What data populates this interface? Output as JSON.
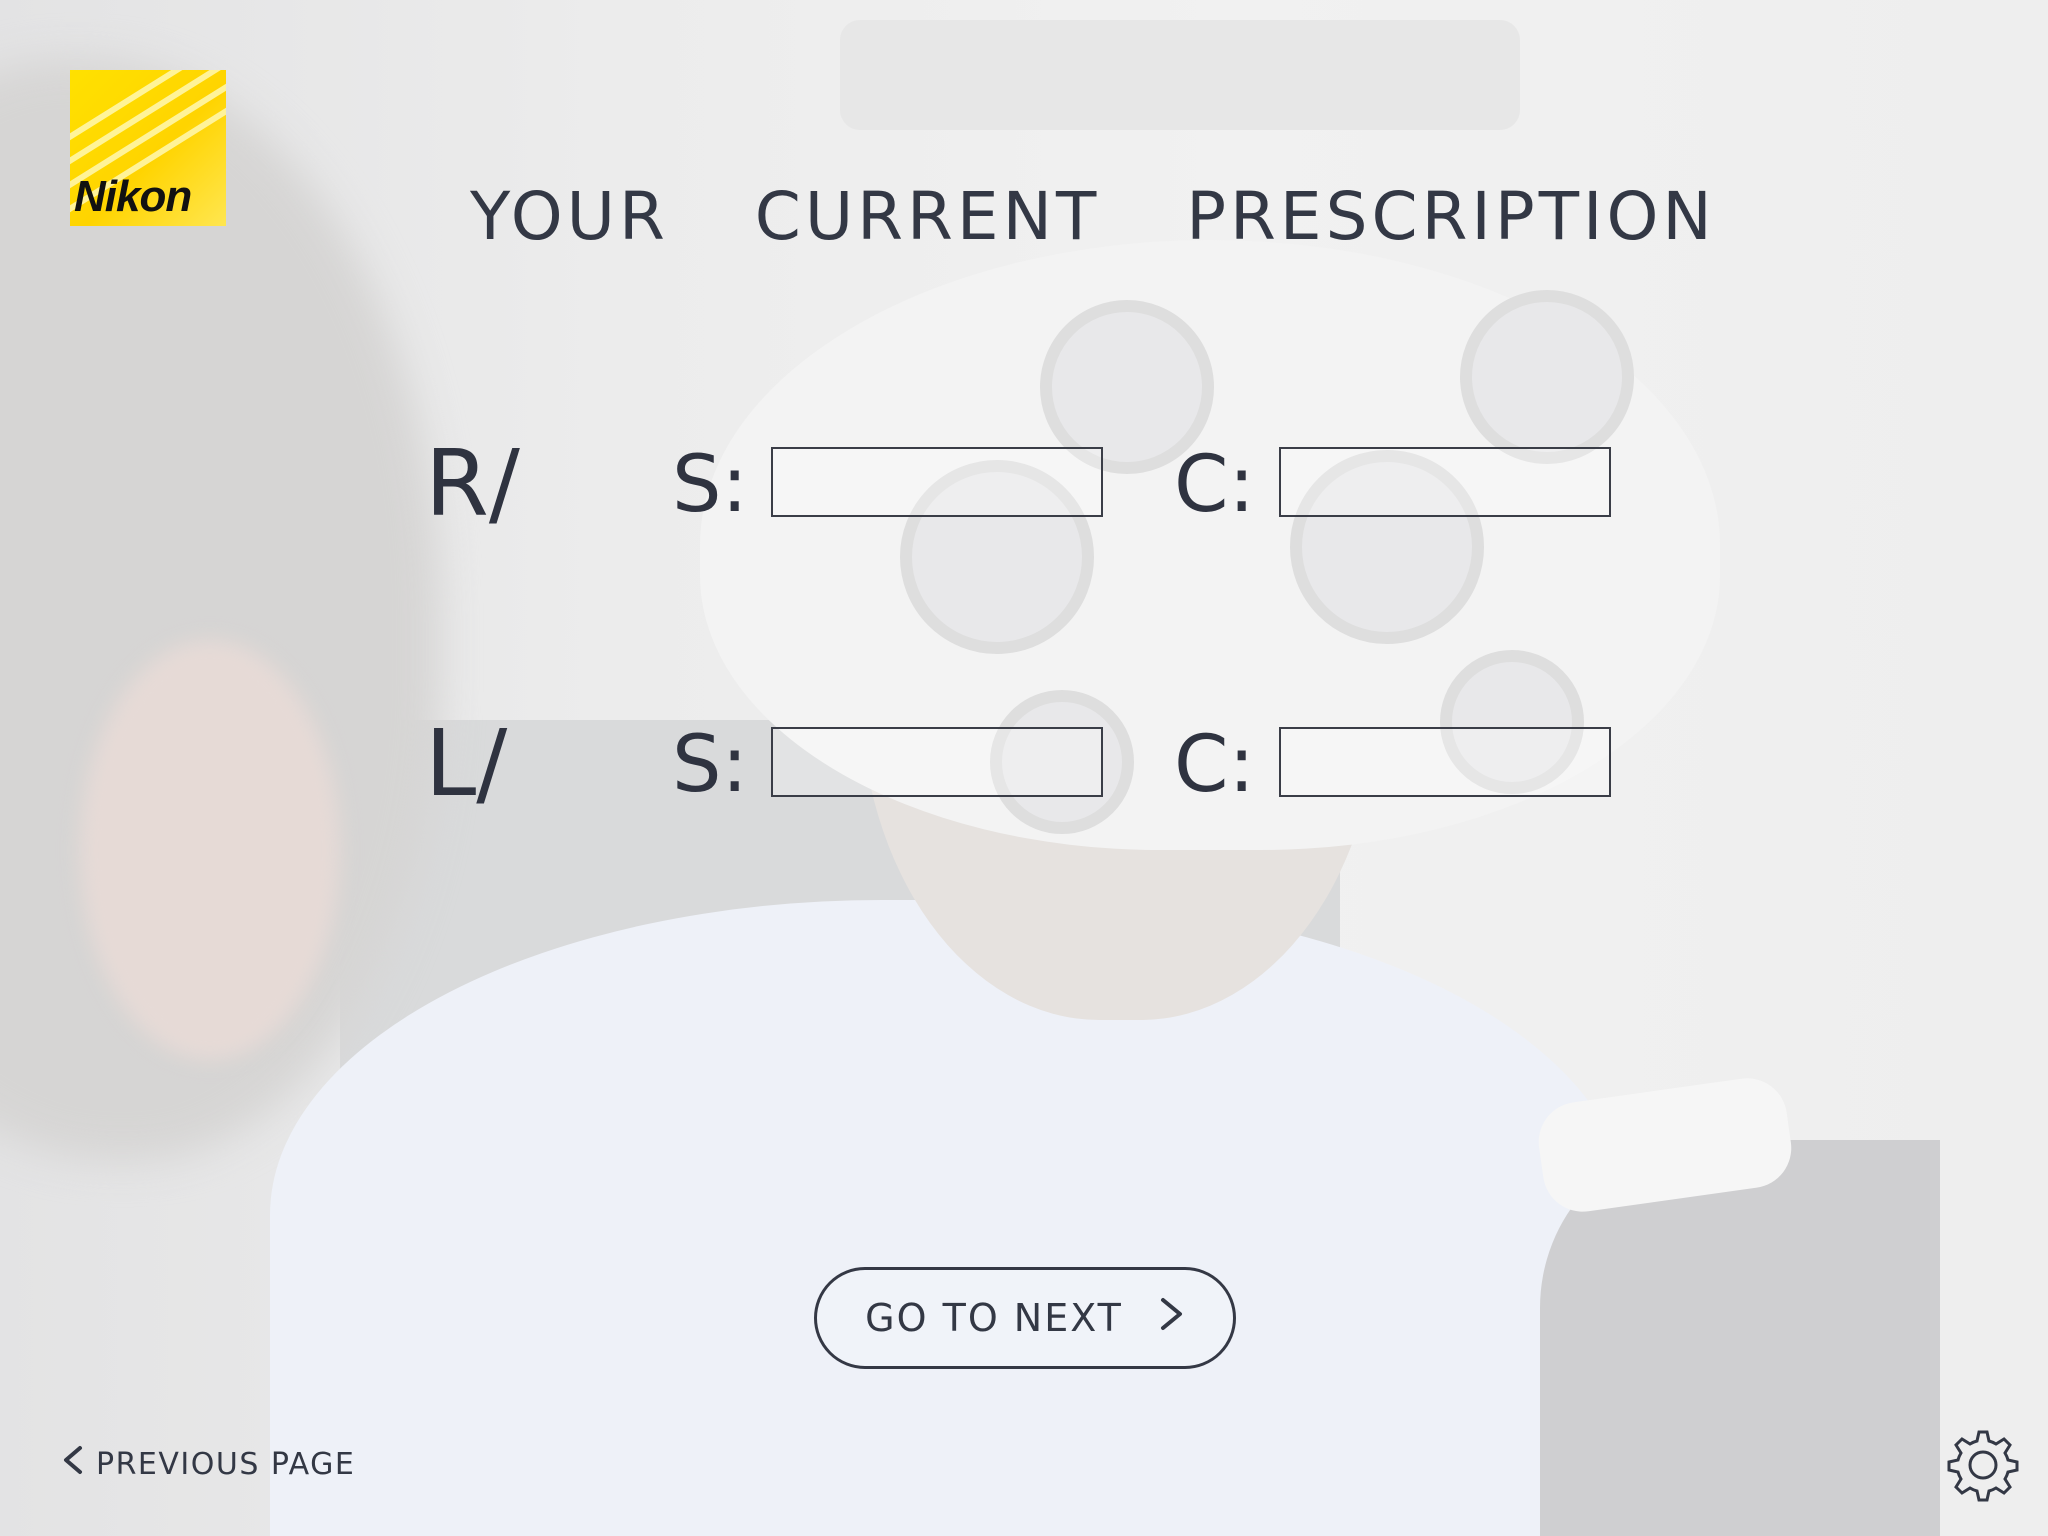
{
  "brand": {
    "logo_text": "Nikon"
  },
  "page": {
    "title": "YOUR  CURRENT  PRESCRIPTION"
  },
  "prescription": {
    "right": {
      "eye_label": "R/",
      "sphere_label": "S:",
      "cylinder_label": "C:",
      "sphere_value": "",
      "cylinder_value": ""
    },
    "left": {
      "eye_label": "L/",
      "sphere_label": "S:",
      "cylinder_label": "C:",
      "sphere_value": "",
      "cylinder_value": ""
    }
  },
  "actions": {
    "next_label": "GO TO NEXT",
    "next_icon": "chevron-right-icon",
    "prev_label": "PREVIOUS PAGE",
    "prev_icon": "chevron-left-icon",
    "settings_icon": "gear-icon"
  },
  "colors": {
    "text": "#2f3340",
    "brand_yellow": "#ffe100"
  }
}
